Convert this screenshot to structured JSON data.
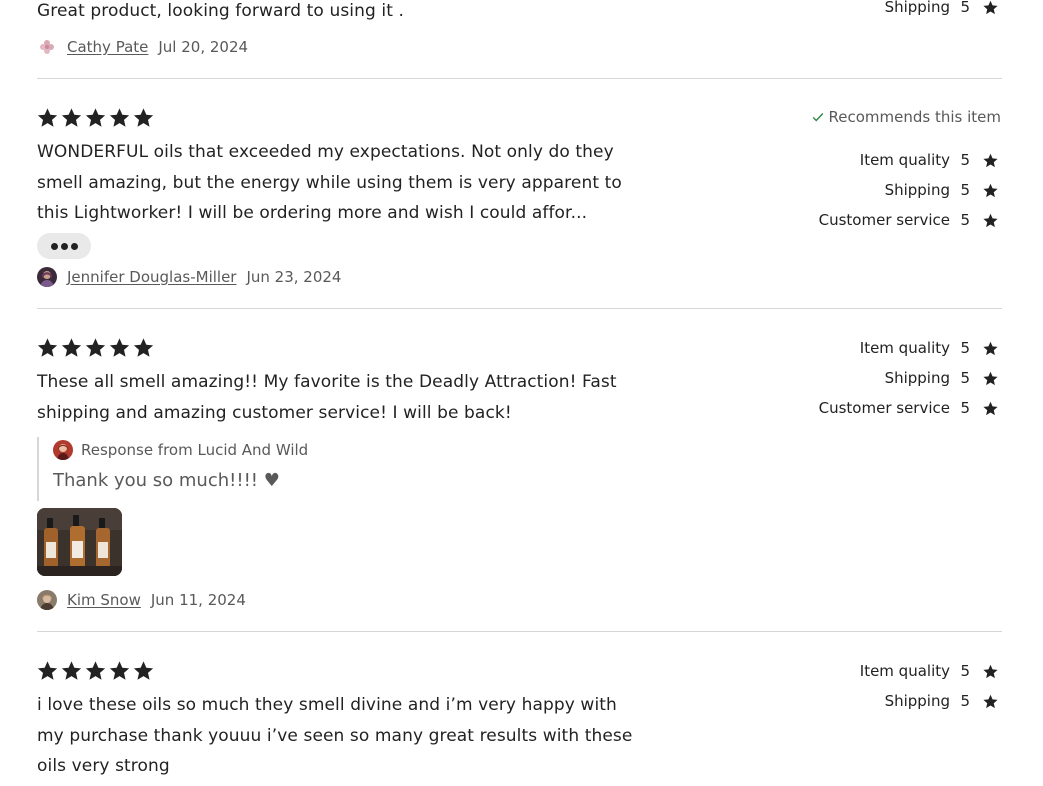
{
  "colors": {
    "text": "#222222",
    "muted": "#595959",
    "divider": "#d6d6d6",
    "check": "#2e8540",
    "pill": "#e9e9e9"
  },
  "icons": {
    "star": "star-icon",
    "check": "check-icon",
    "more": "more-dots-icon"
  },
  "reviews": [
    {
      "text": "Great product, looking forward to using it .",
      "author": "Cathy Pate",
      "date": "Jul 20, 2024",
      "ratings": [
        {
          "label": "Shipping",
          "value": "5"
        }
      ]
    },
    {
      "stars": 5,
      "recommends": "Recommends this item",
      "text": "WONDERFUL oils that exceeded my expectations. Not only do they smell amazing, but the energy while using them is very apparent to this Lightworker! I will be ordering more and wish I could affor...",
      "author": "Jennifer Douglas-Miller",
      "date": "Jun 23, 2024",
      "ratings": [
        {
          "label": "Item quality",
          "value": "5"
        },
        {
          "label": "Shipping",
          "value": "5"
        },
        {
          "label": "Customer service",
          "value": "5"
        }
      ]
    },
    {
      "stars": 5,
      "text": "These all smell amazing!! My favorite is the Deadly Attraction! Fast shipping and amazing customer service! I will be back!",
      "response_label": "Response from Lucid And Wild",
      "response_text": "Thank you so much!!!! ♥",
      "author": "Kim Snow",
      "date": "Jun 11, 2024",
      "ratings": [
        {
          "label": "Item quality",
          "value": "5"
        },
        {
          "label": "Shipping",
          "value": "5"
        },
        {
          "label": "Customer service",
          "value": "5"
        }
      ]
    },
    {
      "stars": 5,
      "text": "i love these oils so much they smell divine and i’m very happy with my purchase thank youuu i’ve seen so many great results with these oils very strong",
      "ratings": [
        {
          "label": "Item quality",
          "value": "5"
        },
        {
          "label": "Shipping",
          "value": "5"
        }
      ]
    }
  ]
}
